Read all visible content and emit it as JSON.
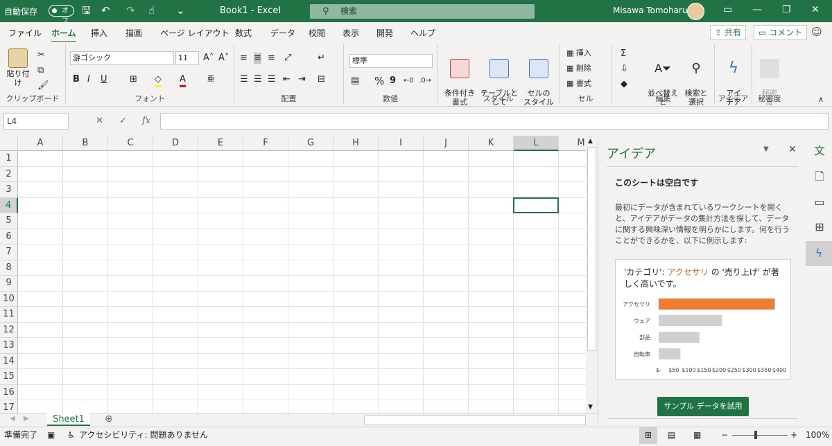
{
  "titlebar": {
    "autosave_label": "自動保存",
    "autosave_state": "オフ",
    "doc_title": "Book1  -  Excel",
    "search_placeholder": "検索",
    "user_name": "Misawa Tomoharu"
  },
  "menu": {
    "tabs": [
      "ファイル",
      "ホーム",
      "挿入",
      "描画",
      "ページ レイアウト",
      "数式",
      "データ",
      "校閲",
      "表示",
      "開発",
      "ヘルプ"
    ],
    "active_tab": "ホーム",
    "share": "共有",
    "comment": "コメント"
  },
  "ribbon": {
    "clipboard": {
      "paste": "貼り付け",
      "label": "クリップボード"
    },
    "font": {
      "name": "游ゴシック",
      "size": "11",
      "label": "フォント"
    },
    "alignment": {
      "label": "配置"
    },
    "number": {
      "format": "標準",
      "label": "数値"
    },
    "styles": {
      "cond": "条件付き\n書式",
      "table": "テーブルとして\n書式設定",
      "cell": "セルの\nスタイル",
      "label": "スタイル"
    },
    "cells": {
      "insert": "挿入",
      "delete": "削除",
      "format": "書式",
      "label": "セル"
    },
    "editing": {
      "sort": "並べ替えと\nフィルター",
      "find": "検索と\n選択",
      "label": "編集"
    },
    "ideas": {
      "btn": "アイ\nデア",
      "label": "アイデア"
    },
    "sensitivity": {
      "btn": "秘密\n度",
      "label": "秘密度"
    }
  },
  "formula_bar": {
    "name_box": "L4",
    "formula": ""
  },
  "grid": {
    "columns": [
      "A",
      "B",
      "C",
      "D",
      "E",
      "F",
      "G",
      "H",
      "I",
      "J",
      "K",
      "L",
      "M"
    ],
    "rows": [
      "1",
      "2",
      "3",
      "4",
      "5",
      "6",
      "7",
      "8",
      "9",
      "10",
      "11",
      "12",
      "13",
      "14",
      "15",
      "16",
      "17"
    ],
    "selected_col": "L",
    "selected_row": "4"
  },
  "sheets": {
    "active": "Sheet1"
  },
  "status": {
    "ready": "準備完了",
    "accessibility": "アクセシビリティ: 問題ありません",
    "zoom": "100%"
  },
  "ideas_pane": {
    "title": "アイデア",
    "subtitle": "このシートは空白です",
    "description": "最初にデータが含まれているワークシートを開くと、アイデアがデータの集計方法を探して、データに関する興味深い情報を明らかにします。何を行うことができるかを、以下に例示します:",
    "card_prefix": "'カテゴリ': ",
    "card_accent": "アクセサリ",
    "card_suffix": " の '売り上げ' が著しく高いです。",
    "try_button": "サンプル データを試用"
  },
  "chart_data": {
    "type": "bar",
    "categories": [
      "アクセサリ",
      "ウェア",
      "部品",
      "自転車"
    ],
    "values": [
      385,
      210,
      135,
      72
    ],
    "tick_labels": [
      "$-",
      "$50",
      "$100",
      "$150",
      "$200",
      "$250",
      "$300",
      "$350",
      "$400"
    ],
    "xlim": [
      0,
      400
    ],
    "highlight_color": "#ed7d31",
    "other_color": "#d0d0d0"
  },
  "colors": {
    "accent": "#217346"
  }
}
